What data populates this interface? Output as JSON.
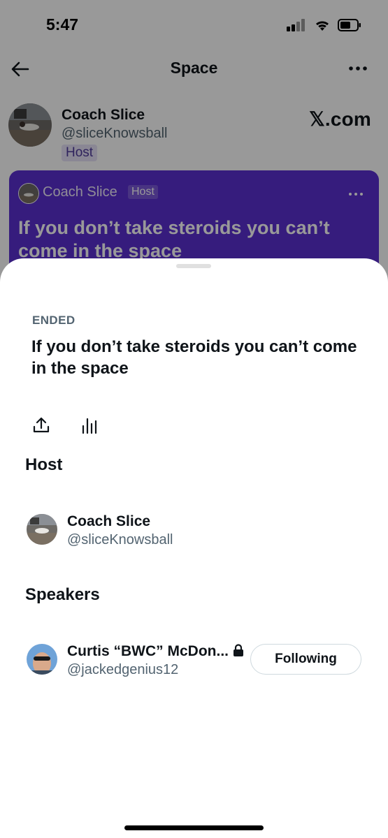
{
  "status_bar": {
    "time": "5:47"
  },
  "header": {
    "title": "Space"
  },
  "host_strip": {
    "name": "Coach Slice",
    "handle": "@sliceKnowsball",
    "badge": "Host",
    "watermark": "𝕏.com"
  },
  "space_card": {
    "host_name": "Coach Slice",
    "host_badge": "Host",
    "title": "If you don’t take steroids you can’t come in the space",
    "color": "#5b2fd0"
  },
  "sheet": {
    "status": "ENDED",
    "title": "If you don’t take steroids you can’t come in the space",
    "icons": [
      "share-icon",
      "stats-icon"
    ],
    "host_section": {
      "heading": "Host",
      "user": {
        "name": "Coach Slice",
        "handle": "@sliceKnowsball"
      }
    },
    "speakers_section": {
      "heading": "Speakers",
      "users": [
        {
          "name": "Curtis “BWC” McDon...",
          "handle": "@jackedgenius12",
          "protected": true,
          "button": "Following"
        }
      ]
    }
  }
}
